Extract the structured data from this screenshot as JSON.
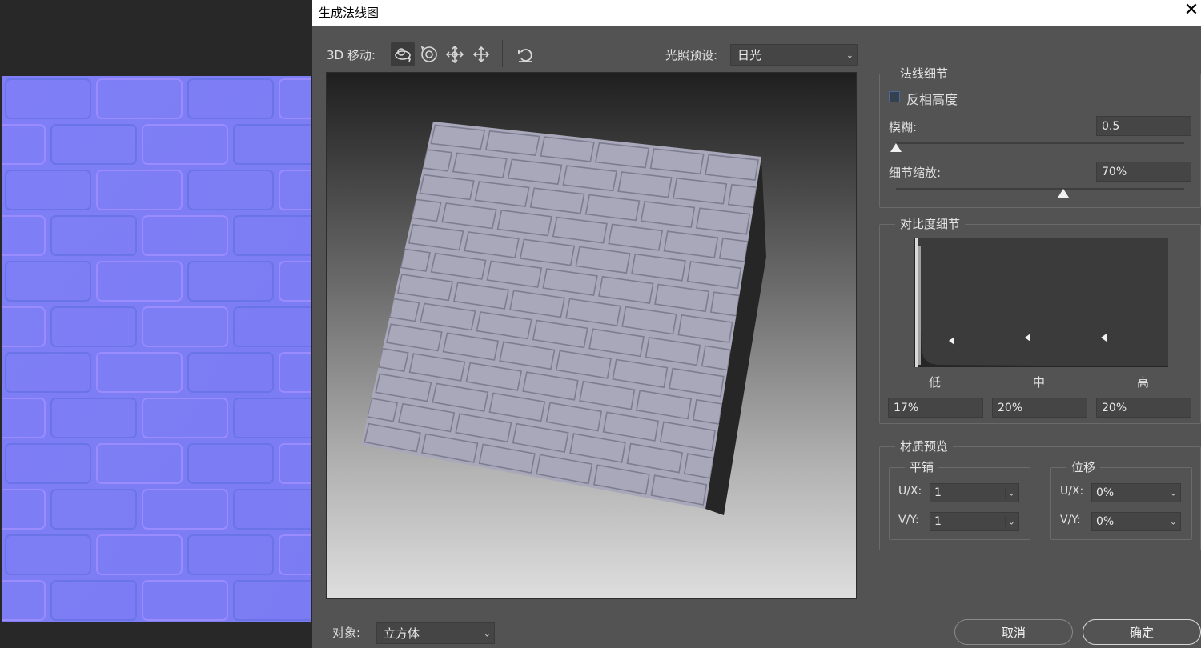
{
  "dialog": {
    "title": "生成法线图",
    "close_glyph": "✕"
  },
  "toolbar": {
    "move_label": "3D 移动:",
    "tools": [
      {
        "name": "orbit-icon",
        "active": true
      },
      {
        "name": "roll-icon",
        "active": false
      },
      {
        "name": "pan-icon",
        "active": false
      },
      {
        "name": "slide-icon",
        "active": false
      },
      {
        "name": "reset-view-icon",
        "active": false
      }
    ],
    "lighting_label": "光照预设:",
    "lighting_value": "日光"
  },
  "normal_detail": {
    "title": "法线细节",
    "invert_height_label": "反相高度",
    "invert_height_checked": false,
    "blur_label": "模糊:",
    "blur_value": "0.5",
    "blur_level": 0.0,
    "detail_scale_label": "细节缩放:",
    "detail_scale_value": "70%",
    "detail_scale_level": 0.58
  },
  "contrast_detail": {
    "title": "对比度细节",
    "low_label": "低",
    "mid_label": "中",
    "high_label": "高",
    "low_value": "17%",
    "mid_value": "20%",
    "high_value": "20%"
  },
  "material_preview": {
    "title": "材质预览",
    "tiling": {
      "title": "平铺",
      "ux_label": "U/X:",
      "ux_value": "1",
      "vy_label": "V/Y:",
      "vy_value": "1"
    },
    "offset": {
      "title": "位移",
      "ux_label": "U/X:",
      "ux_value": "0%",
      "vy_label": "V/Y:",
      "vy_value": "0%"
    }
  },
  "footer": {
    "object_label": "对象:",
    "object_value": "立方体",
    "cancel_label": "取消",
    "ok_label": "确定"
  },
  "colors": {
    "dialog_bg": "#535353",
    "normal_map_base": "#7d7cf5",
    "brick_surface": "#a9a8bb"
  }
}
